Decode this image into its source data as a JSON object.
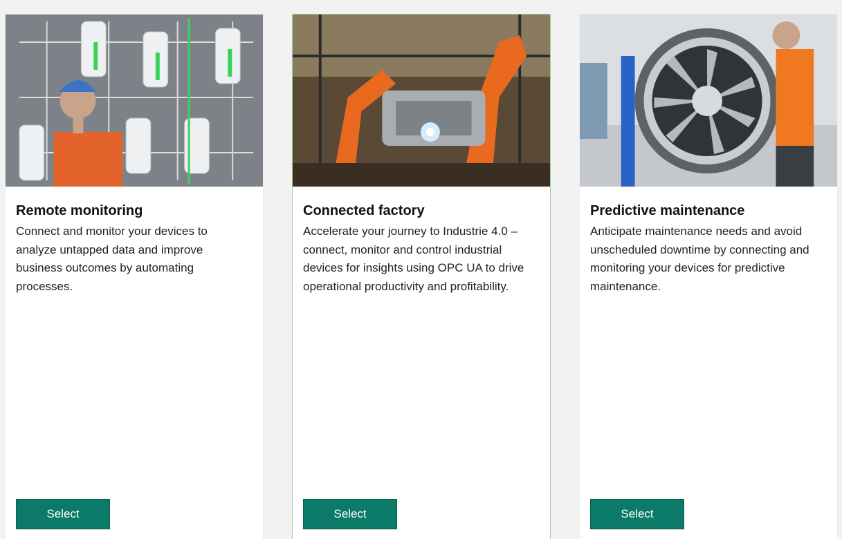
{
  "cards": [
    {
      "title": "Remote monitoring",
      "description": "Connect and monitor your devices to analyze untapped data and improve business outcomes by automating processes.",
      "button_label": "Select",
      "image": "worker-with-control-panel-photo",
      "selected": false
    },
    {
      "title": "Connected factory",
      "description": "Accelerate your journey to Industrie 4.0 – connect, monitor and control industrial devices for insights using OPC UA to drive operational productivity and profitability.",
      "button_label": "Select",
      "image": "robotic-assembly-line-photo",
      "selected": true
    },
    {
      "title": "Predictive maintenance",
      "description": "Anticipate maintenance needs and avoid unscheduled downtime by connecting and monitoring your devices for predictive maintenance.",
      "button_label": "Select",
      "image": "jet-engine-inspection-photo",
      "selected": false
    }
  ],
  "colors": {
    "background": "#f2f2f2",
    "button": "#0b7a69",
    "selected_border": "#9ad39d"
  }
}
